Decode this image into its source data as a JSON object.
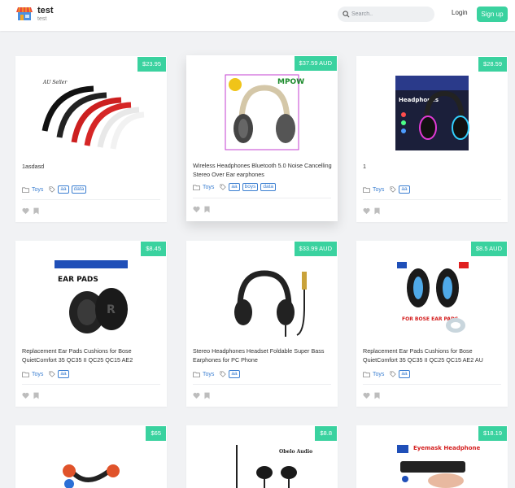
{
  "header": {
    "title": "test",
    "subtitle": "test",
    "search_placeholder": "Search..",
    "login_label": "Login",
    "signup_label": "Sign up"
  },
  "colors": {
    "accent": "#3ad29f",
    "link": "#3c7fd1",
    "background": "#f1f2f4"
  },
  "products": [
    {
      "price": "$23.95",
      "title": "1asdasd",
      "category": "Toys",
      "tags": [
        "aa",
        "data"
      ],
      "image": "headband-parts-image",
      "image_text": "AU Seller"
    },
    {
      "price": "$37.59 AUD",
      "title": "Wireless Headphones Bluetooth 5.0 Noise Cancelling Stereo Over Ear earphones",
      "category": "Toys",
      "tags": [
        "aa",
        "boys",
        "data"
      ],
      "image": "mpow-headphones-image",
      "image_text": "MPOW"
    },
    {
      "price": "$28.59",
      "title": "1",
      "category": "Toys",
      "tags": [
        "aa"
      ],
      "image": "rgb-headphones-image",
      "image_text": "Headphones"
    },
    {
      "price": "$8.45",
      "title": "Replacement Ear Pads Cushions for Bose QuietComfort 35 QC35 II QC25 QC15 AE2",
      "category": "Toys",
      "tags": [
        "aa"
      ],
      "image": "ear-pads-image",
      "image_text": "EAR PADS"
    },
    {
      "price": "$33.99 AUD",
      "title": "Stereo Headphones Headset Foldable Super Bass Earphones for PC Phone",
      "category": "Toys",
      "tags": [
        "aa"
      ],
      "image": "wired-headphones-image",
      "image_text": ""
    },
    {
      "price": "$8.5 AUD",
      "title": "Replacement Ear Pads Cushions for Bose QuietComfort 35 QC35 II QC25 QC15 AE2 AU",
      "category": "Toys",
      "tags": [
        "aa"
      ],
      "image": "blue-ear-pads-image",
      "image_text": "FOR BOSE EAR PADS"
    },
    {
      "price": "$65",
      "title": "",
      "category": "",
      "tags": [],
      "image": "neckband-earphones-image",
      "image_text": ""
    },
    {
      "price": "$8.8",
      "title": "",
      "category": "",
      "tags": [],
      "image": "earbuds-image",
      "image_text": "Obelo Audio"
    },
    {
      "price": "$18.19",
      "title": "",
      "category": "",
      "tags": [],
      "image": "eye-mask-image",
      "image_text": "Eyemask Headphone"
    }
  ]
}
